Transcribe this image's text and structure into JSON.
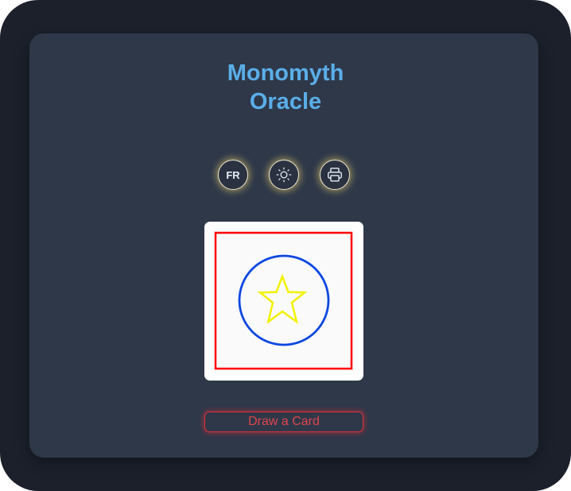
{
  "app": {
    "title_line1": "Monomyth",
    "title_line2": "Oracle",
    "accent_color": "#5aaee8"
  },
  "toolbar": {
    "language_label": "FR",
    "theme_icon": "sun-icon",
    "print_icon": "printer-icon"
  },
  "card": {
    "frame_color": "#ff0000",
    "circle_color": "#0d47e0",
    "star_color": "#f2f200",
    "icon": "star-icon"
  },
  "actions": {
    "draw_label": "Draw a Card"
  }
}
